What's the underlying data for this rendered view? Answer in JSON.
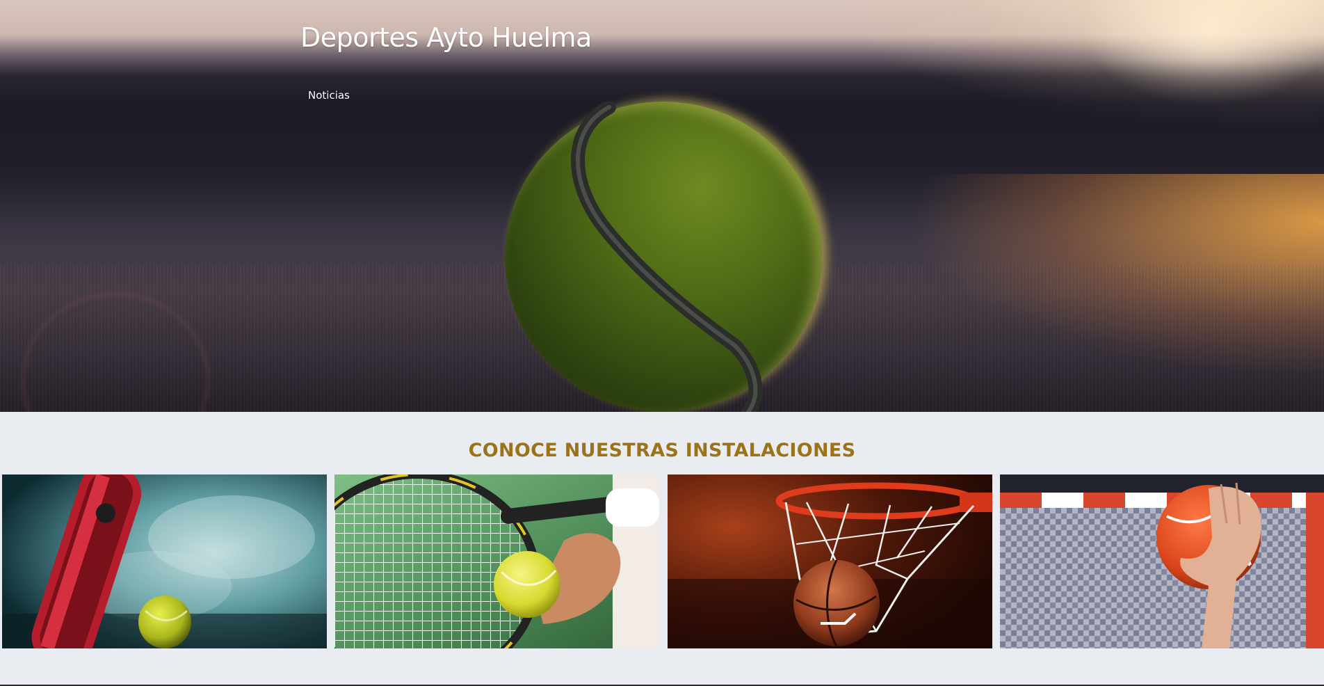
{
  "header": {
    "site_title": "Deportes Ayto Huelma",
    "nav": [
      {
        "label": "Noticias"
      }
    ],
    "hero_image": "tennis-ball-on-court"
  },
  "facilities": {
    "title": "CONOCE NUESTRAS INSTALACIONES",
    "cards": [
      {
        "image": "padel-racket-and-ball-smoke"
      },
      {
        "image": "tennis-racket-and-ball-serve"
      },
      {
        "image": "basketball-in-hoop-net"
      },
      {
        "image": "handball-in-hand-goal"
      }
    ]
  },
  "colors": {
    "section_title": "#9c7319",
    "page_background": "#e9ecf0",
    "header_text": "#ffffff"
  }
}
